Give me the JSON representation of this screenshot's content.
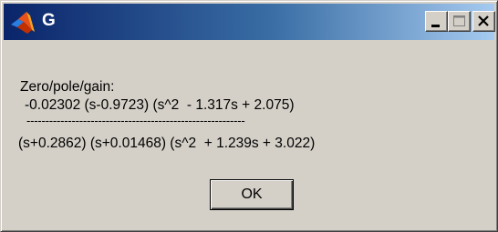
{
  "window": {
    "title": "G",
    "accent_color": "#0a246a",
    "controls": {
      "minimize": "minimize-icon",
      "maximize": "maximize-icon",
      "close": "close-icon"
    }
  },
  "message": {
    "heading": "Zero/pole/gain:",
    "numerator": "-0.02302 (s-0.9723) (s^2  - 1.317s + 2.075)",
    "divider": "----------------------------------------------------------",
    "denominator": "(s+0.2862) (s+0.01468) (s^2  + 1.239s + 3.022)"
  },
  "buttons": {
    "ok_label": "OK"
  }
}
